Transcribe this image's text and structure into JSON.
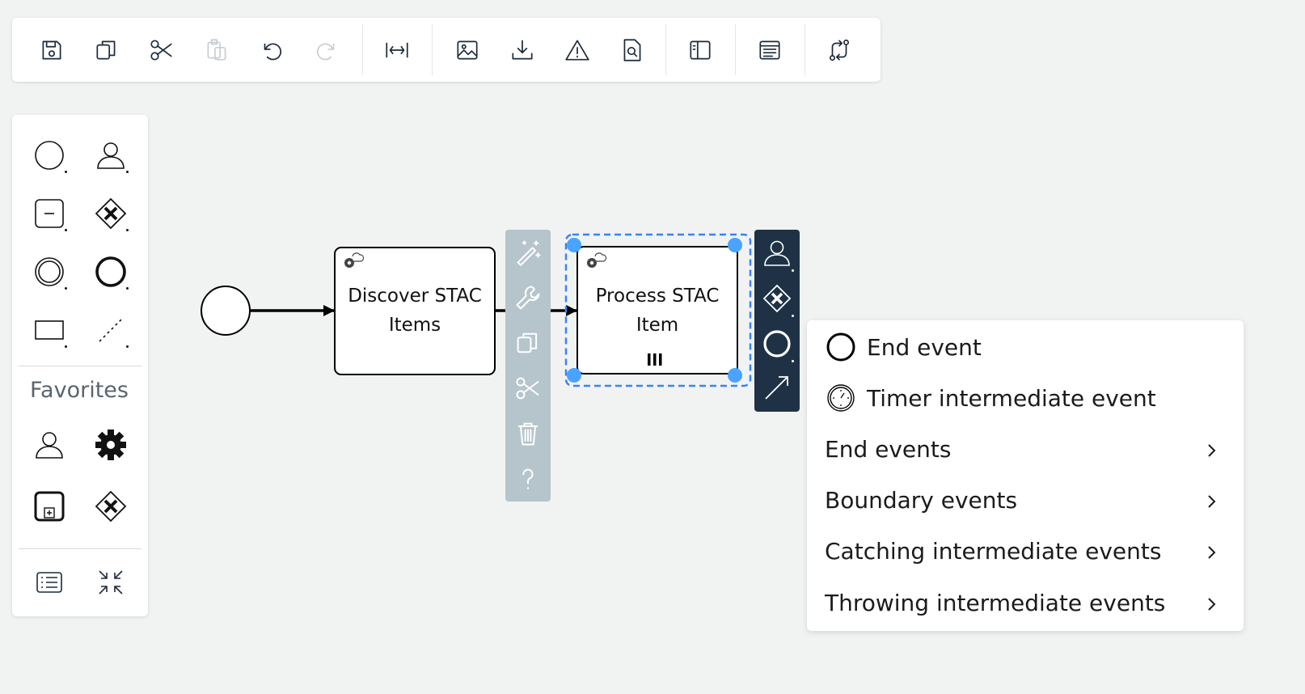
{
  "toolbar": {
    "buttons": [
      "save",
      "copy",
      "cut",
      "paste",
      "undo",
      "redo",
      "align",
      "export-image",
      "download",
      "validate",
      "search",
      "properties-panel",
      "details",
      "swap"
    ]
  },
  "palette": {
    "favorites_label": "Favorites"
  },
  "diagram": {
    "task1_label_line1": "Discover STAC",
    "task1_label_line2": "Items",
    "task2_label_line1": "Process STAC",
    "task2_label_line2": "Item"
  },
  "popup": {
    "items": [
      {
        "label": "End event",
        "icon": "end-event-icon",
        "submenu": false
      },
      {
        "label": "Timer intermediate event",
        "icon": "timer-icon",
        "submenu": false
      },
      {
        "label": "End events",
        "icon": "",
        "submenu": true
      },
      {
        "label": "Boundary events",
        "icon": "",
        "submenu": true
      },
      {
        "label": "Catching intermediate events",
        "icon": "",
        "submenu": true
      },
      {
        "label": "Throwing intermediate events",
        "icon": "",
        "submenu": true
      }
    ]
  },
  "colors": {
    "selection": "#3b82f6",
    "handle": "#4aa3ff",
    "context_pad": "#b6c4cc",
    "append_pad": "#1f3245",
    "background": "#f1f3f2"
  }
}
